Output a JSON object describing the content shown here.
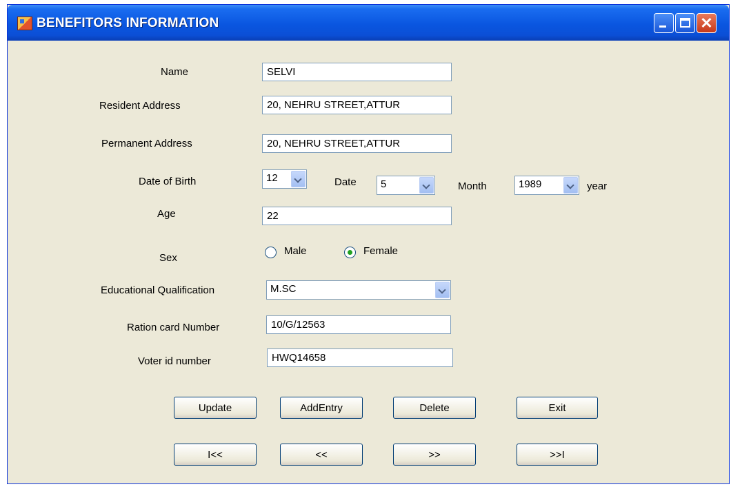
{
  "window": {
    "title": "BENEFITORS INFORMATION",
    "close_glyph": "✕"
  },
  "labels": {
    "name": "Name",
    "resident_address": "Resident Address",
    "permanent_address": "Permanent Address",
    "dob": "Date of Birth",
    "date_unit": "Date",
    "month_unit": "Month",
    "year_unit": "year",
    "age": "Age",
    "sex": "Sex",
    "education": "Educational Qualification",
    "ration": "Ration card Number",
    "voter": "Voter id number"
  },
  "fields": {
    "name": "SELVI",
    "resident_address": "20, NEHRU STREET,ATTUR",
    "permanent_address": "20, NEHRU STREET,ATTUR",
    "dob_date": "12",
    "dob_month": "5",
    "dob_year": "1989",
    "age": "22",
    "education": "M.SC",
    "ration": "10/G/12563",
    "voter": "HWQ14658"
  },
  "sex": {
    "male_label": "Male",
    "female_label": "Female",
    "selected": "Female"
  },
  "buttons": {
    "update": "Update",
    "add_entry": "AddEntry",
    "delete": "Delete",
    "exit": "Exit",
    "first": "I<<",
    "prev": "<<",
    "next": ">>",
    "last": ">>I"
  },
  "icons": [
    "app-icon",
    "minimize-icon",
    "maximize-icon",
    "close-icon",
    "chevron-down-icon",
    "radio-button-icon"
  ]
}
